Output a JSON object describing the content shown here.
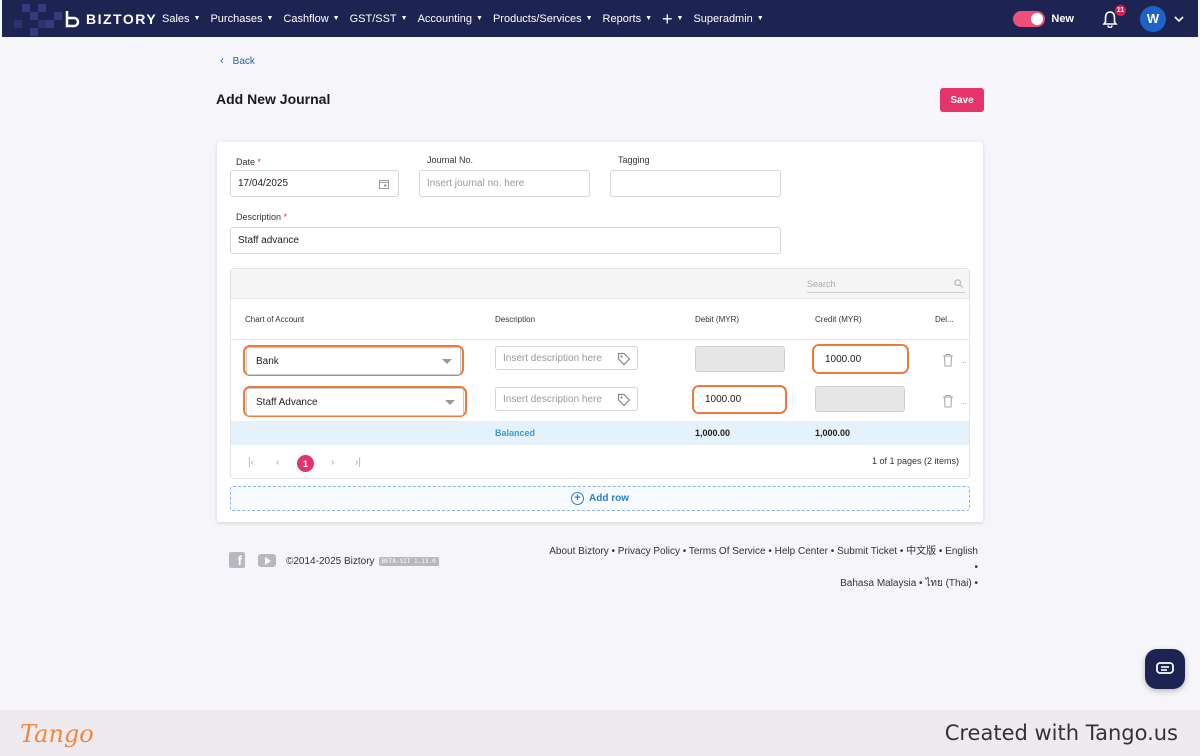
{
  "brand": {
    "name": "BIZTORY",
    "accent": "#e5336b",
    "nav_bg": "#1e2452",
    "highlight": "#f0783a"
  },
  "nav": {
    "items": [
      {
        "label": "Sales"
      },
      {
        "label": "Purchases"
      },
      {
        "label": "Cashflow"
      },
      {
        "label": "GST/SST"
      },
      {
        "label": "Accounting"
      },
      {
        "label": "Products/Services"
      },
      {
        "label": "Reports"
      },
      {
        "label": "+"
      },
      {
        "label": "Superadmin"
      }
    ],
    "toggle_label": "New",
    "notification_count": "11",
    "avatar_initial": "W"
  },
  "page": {
    "back_label": "Back",
    "title": "Add New Journal",
    "save_label": "Save"
  },
  "form": {
    "date_label": "Date",
    "date_value": "17/04/2025",
    "journal_no_label": "Journal No.",
    "journal_no_placeholder": "Insert journal no. here",
    "tagging_label": "Tagging",
    "tagging_value": "",
    "description_label": "Description",
    "description_value": "Staff advance",
    "required_mark": "*"
  },
  "grid": {
    "search_placeholder": "Search",
    "columns": [
      "Chart of Account",
      "Description",
      "Debit (MYR)",
      "Credit (MYR)",
      "Del..."
    ],
    "rows": [
      {
        "account": "Bank",
        "description_placeholder": "Insert description here",
        "debit": "",
        "credit": "1000.00"
      },
      {
        "account": "Staff Advance",
        "description_placeholder": "Insert description here",
        "debit": "1000.00",
        "credit": ""
      }
    ],
    "summary": {
      "status": "Balanced",
      "debit_total": "1,000.00",
      "credit_total": "1,000.00"
    },
    "pager": {
      "current_page": "1",
      "info": "1 of 1 pages (2 items)"
    },
    "add_row_label": "Add row"
  },
  "footer": {
    "copyright": "©2014-2025 Biztory",
    "version_badge": "BETA-SIT 1.13.0",
    "links_line1": "About Biztory • Privacy Policy • Terms Of Service • Help Center • Submit Ticket • 中文版 • English •",
    "links_line2": "Bahasa Malaysia • ไทย (Thai) •"
  },
  "tango": {
    "logo": "Tango",
    "created": "Created with Tango.us"
  }
}
